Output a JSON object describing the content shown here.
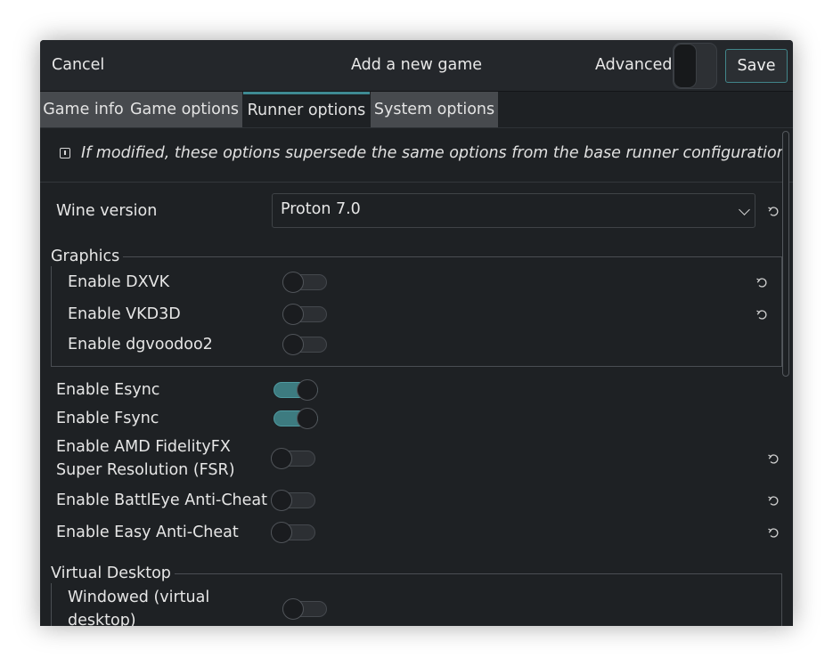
{
  "header": {
    "cancel_label": "Cancel",
    "title": "Add a new game",
    "advanced_label": "Advanced",
    "advanced_on": false,
    "save_label": "Save"
  },
  "tabs": [
    {
      "label": "Game info",
      "active": false
    },
    {
      "label": "Game options",
      "active": false
    },
    {
      "label": "Runner options",
      "active": true
    },
    {
      "label": "System options",
      "active": false
    }
  ],
  "notice": {
    "icon": "info-icon",
    "text": "If modified, these options supersede the same options from the base runner configuration."
  },
  "wine_version": {
    "label": "Wine version",
    "value": "Proton 7.0"
  },
  "graphics": {
    "title": "Graphics",
    "options": [
      {
        "label": "Enable DXVK",
        "on": false,
        "reset": true
      },
      {
        "label": "Enable VKD3D",
        "on": false,
        "reset": true
      },
      {
        "label": "Enable dgvoodoo2",
        "on": false,
        "reset": false
      }
    ]
  },
  "options": [
    {
      "label": "Enable Esync",
      "on": true,
      "reset": false
    },
    {
      "label": "Enable Fsync",
      "on": true,
      "reset": false
    },
    {
      "label": "Enable AMD FidelityFX",
      "label2": "Super Resolution (FSR)",
      "on": false,
      "reset": true
    },
    {
      "label": "Enable BattlEye Anti-Cheat",
      "on": false,
      "reset": true
    },
    {
      "label": "Enable Easy Anti-Cheat",
      "on": false,
      "reset": true
    }
  ],
  "virtual_desktop": {
    "title": "Virtual Desktop",
    "options": [
      {
        "label": "Windowed (virtual",
        "label2": "desktop)",
        "on": false
      }
    ]
  },
  "colors": {
    "accent": "#3e8a92",
    "background": "#1e2124",
    "tab_inactive": "#474a4e"
  }
}
